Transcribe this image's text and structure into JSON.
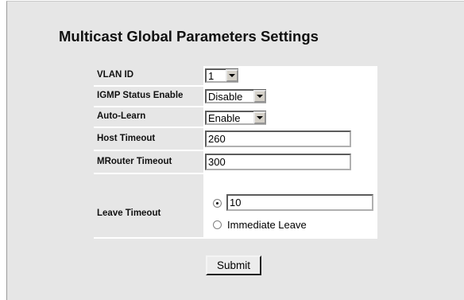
{
  "title": "Multicast Global Parameters Settings",
  "fields": {
    "vlan_id": {
      "label": "VLAN ID",
      "value": "1"
    },
    "igmp_status": {
      "label": "IGMP Status Enable",
      "value": "Disable"
    },
    "auto_learn": {
      "label": "Auto-Learn",
      "value": "Enable"
    },
    "host_timeout": {
      "label": "Host Timeout",
      "value": "260"
    },
    "mrouter_timeout": {
      "label": "MRouter Timeout",
      "value": "300"
    },
    "leave_timeout": {
      "label": "Leave Timeout",
      "value": "10",
      "immediate_label": "Immediate Leave",
      "selected": "value"
    }
  },
  "submit_label": "Submit"
}
